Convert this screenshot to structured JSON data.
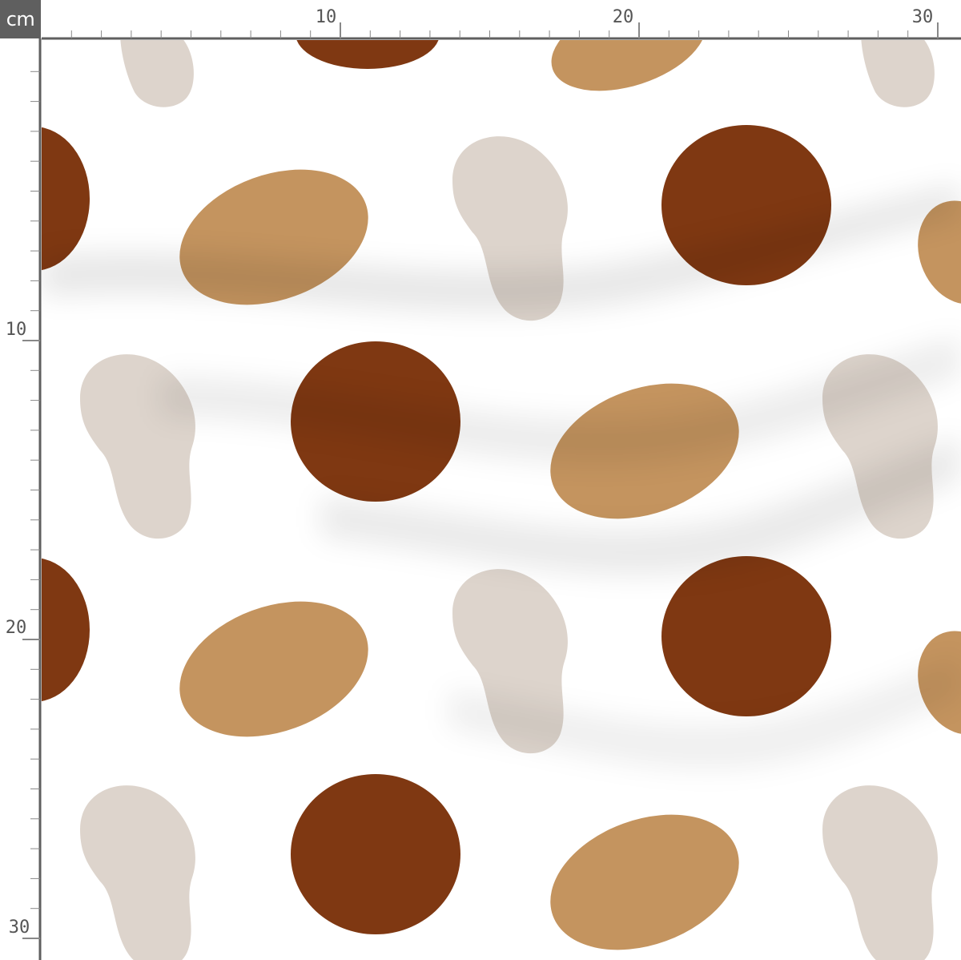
{
  "ruler": {
    "unit": "cm",
    "top_labels": [
      "10",
      "20",
      "30"
    ],
    "left_labels": [
      "10",
      "20",
      "30"
    ]
  },
  "pattern": {
    "background": "#ffffff",
    "colors": {
      "rust_dot": "#7f3812",
      "tan_oval": "#c4945f",
      "beige_bean": "#ddd4cc"
    },
    "shapes": [
      "rust-dot",
      "tan-oval",
      "beige-bean"
    ]
  }
}
